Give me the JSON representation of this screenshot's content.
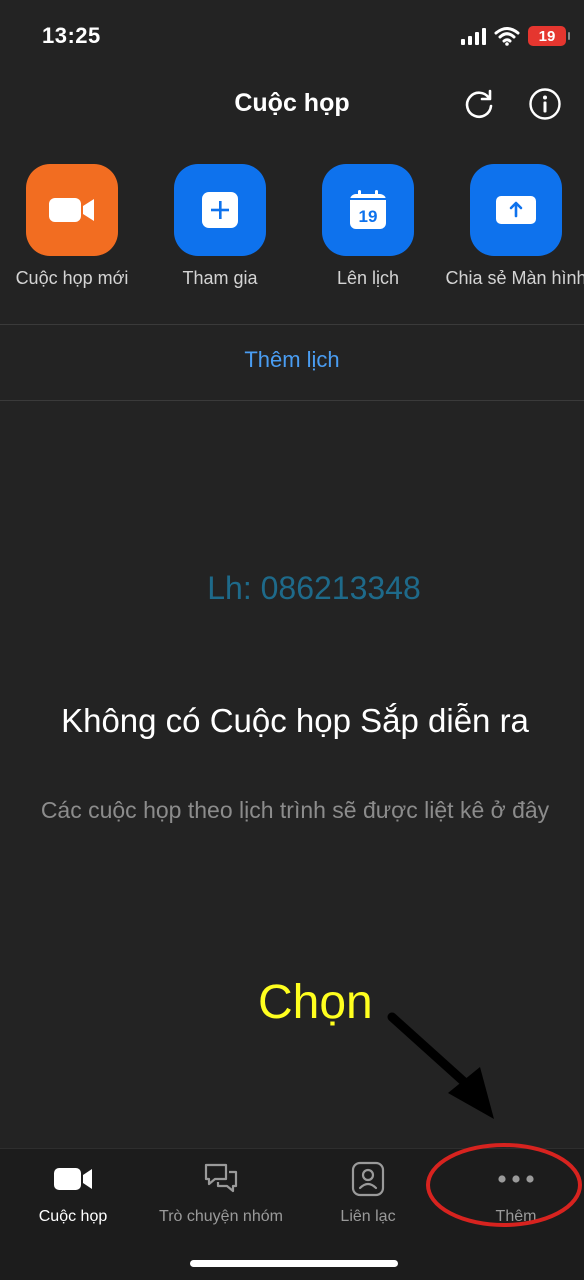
{
  "status": {
    "time": "13:25",
    "battery": "19",
    "icons": [
      "signal-icon",
      "wifi-icon",
      "battery-icon"
    ]
  },
  "header": {
    "title": "Cuộc họp",
    "icons": [
      "refresh-icon",
      "info-icon"
    ]
  },
  "actions": [
    {
      "label": "Cuộc họp mới",
      "icon": "video-camera-icon",
      "color": "#f26d21"
    },
    {
      "label": "Tham gia",
      "icon": "plus-icon",
      "color": "#0e72ed"
    },
    {
      "label": "Lên lịch",
      "icon": "calendar-icon",
      "icon_text": "19",
      "color": "#0e72ed"
    },
    {
      "label": "Chia sẻ Màn hình",
      "icon": "share-screen-icon",
      "color": "#0e72ed"
    }
  ],
  "add_calendar": "Thêm lịch",
  "watermark": "Lh: 086213348",
  "empty_state": {
    "title": "Không có Cuộc họp Sắp diễn ra",
    "subtitle": "Các cuộc họp theo lịch trình sẽ được liệt kê ở đây"
  },
  "annotation": {
    "text": "Chọn",
    "text_color": "#ffff1f",
    "circle_color": "#d7231f"
  },
  "tabs": [
    {
      "label": "Cuộc họp",
      "icon": "video-camera-icon",
      "active": true
    },
    {
      "label": "Trò chuyện nhóm",
      "icon": "chat-icon",
      "active": false
    },
    {
      "label": "Liên lạc",
      "icon": "contacts-icon",
      "active": false
    },
    {
      "label": "Thêm",
      "icon": "more-icon",
      "active": false
    }
  ]
}
